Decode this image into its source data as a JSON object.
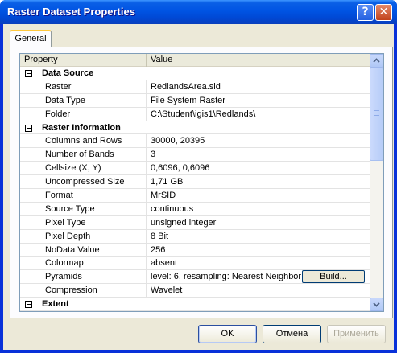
{
  "window": {
    "title": "Raster Dataset Properties"
  },
  "tabs": [
    {
      "label": "General"
    }
  ],
  "grid": {
    "columns": [
      "Property",
      "Value"
    ],
    "sections": [
      {
        "name": "Data Source",
        "expanded": true,
        "rows": [
          {
            "key": "Raster",
            "value": "RedlandsArea.sid"
          },
          {
            "key": "Data Type",
            "value": "File System Raster"
          },
          {
            "key": "Folder",
            "value": "C:\\Student\\igis1\\Redlands\\"
          }
        ]
      },
      {
        "name": "Raster Information",
        "expanded": true,
        "rows": [
          {
            "key": "Columns and Rows",
            "value": "30000, 20395"
          },
          {
            "key": "Number of Bands",
            "value": "3"
          },
          {
            "key": "Cellsize (X, Y)",
            "value": "0,6096, 0,6096"
          },
          {
            "key": "Uncompressed Size",
            "value": "1,71 GB"
          },
          {
            "key": "Format",
            "value": "MrSID"
          },
          {
            "key": "Source Type",
            "value": "continuous"
          },
          {
            "key": "Pixel Type",
            "value": "unsigned integer"
          },
          {
            "key": "Pixel Depth",
            "value": "8 Bit"
          },
          {
            "key": "NoData Value",
            "value": "256"
          },
          {
            "key": "Colormap",
            "value": "absent"
          },
          {
            "key": "Pyramids",
            "value": "level: 6, resampling: Nearest Neighbor",
            "button": "Build..."
          },
          {
            "key": "Compression",
            "value": "Wavelet"
          }
        ]
      },
      {
        "name": "Extent",
        "expanded": true,
        "rows": []
      }
    ]
  },
  "buttons": {
    "ok": "OK",
    "cancel": "Отмена",
    "apply": "Применить"
  },
  "icons": {
    "help": "help-icon",
    "close": "close-icon"
  }
}
